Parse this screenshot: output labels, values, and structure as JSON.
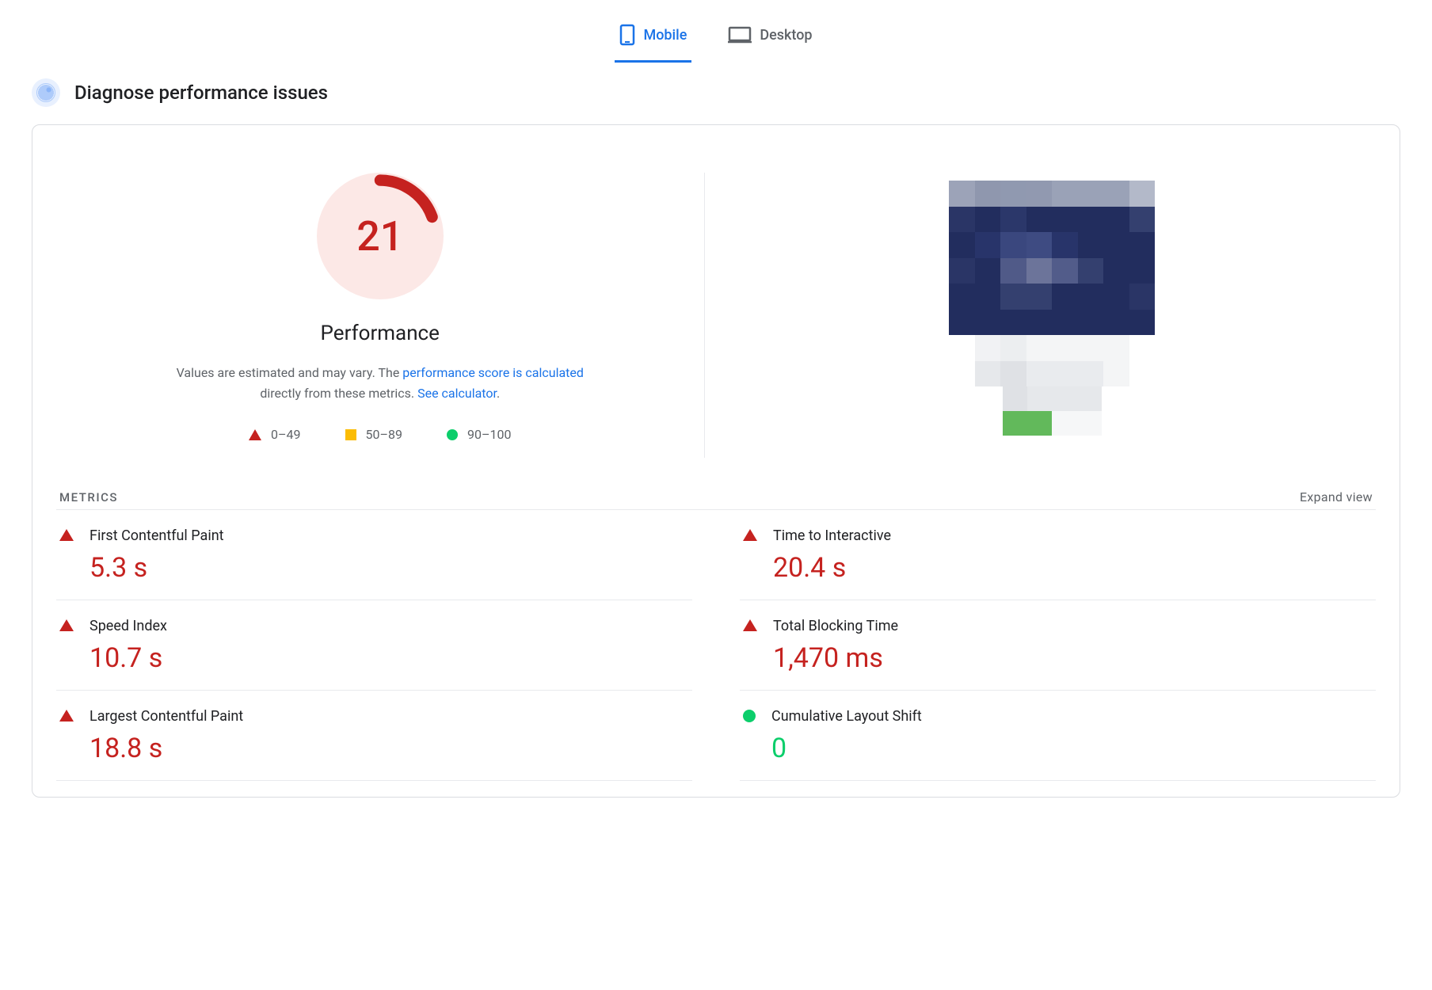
{
  "tabs": {
    "mobile": "Mobile",
    "desktop": "Desktop",
    "active": "mobile"
  },
  "section_title": "Diagnose performance issues",
  "performance": {
    "score": "21",
    "score_status": "red",
    "label": "Performance",
    "desc_prefix": "Values are estimated and may vary. The ",
    "link1": "performance score is calculated",
    "desc_mid": " directly from these metrics. ",
    "link2": "See calculator",
    "desc_suffix": "."
  },
  "legend": {
    "range_red": "0–49",
    "range_orange": "50–89",
    "range_green": "90–100"
  },
  "metrics_header": "METRICS",
  "expand_view": "Expand view",
  "metrics": [
    {
      "name": "First Contentful Paint",
      "value": "5.3 s",
      "status": "red"
    },
    {
      "name": "Time to Interactive",
      "value": "20.4 s",
      "status": "red"
    },
    {
      "name": "Speed Index",
      "value": "10.7 s",
      "status": "red"
    },
    {
      "name": "Total Blocking Time",
      "value": "1,470 ms",
      "status": "red"
    },
    {
      "name": "Largest Contentful Paint",
      "value": "18.8 s",
      "status": "red"
    },
    {
      "name": "Cumulative Layout Shift",
      "value": "0",
      "status": "green"
    }
  ],
  "colors": {
    "red": "#c5221f",
    "orange": "#fbbc04",
    "green": "#0cce6b",
    "link": "#1a73e8"
  }
}
